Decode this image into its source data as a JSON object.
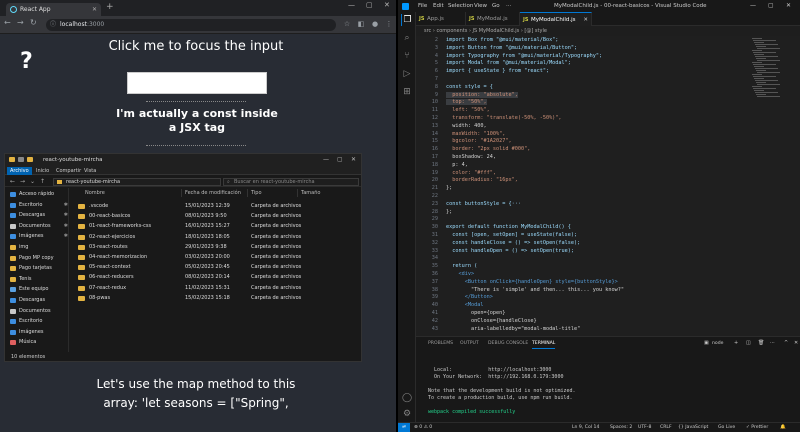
{
  "browser": {
    "tab_title": "React App",
    "url_host": "localhost",
    "url_port": ":3000",
    "content": {
      "focus_text": "Click me to focus the input",
      "question_mark": "?",
      "jsx_text": "I'm actually a const inside a JSX tag",
      "map_text": "Let's use the map method to this array: 'let seasons = [\"Spring\","
    }
  },
  "explorer": {
    "title": "react-youtube-mircha",
    "ribbon_tabs": [
      "Archivo",
      "Inicio",
      "Compartir",
      "Vista"
    ],
    "path": "react-youtube-mircha",
    "search_placeholder": "Buscar en react-youtube-mircha",
    "nav_items": [
      {
        "label": "Acceso rápido",
        "color": "#3d8ee0",
        "active": false
      },
      {
        "label": "Escritorio",
        "color": "#3d8ee0",
        "active": false
      },
      {
        "label": "Descargas",
        "color": "#3d8ee0",
        "active": false
      },
      {
        "label": "Documentos",
        "color": "#c8c8c8",
        "active": false
      },
      {
        "label": "Imágenes",
        "color": "#3d8ee0",
        "active": false
      },
      {
        "label": "img",
        "color": "#e3b341",
        "active": false
      },
      {
        "label": "Pago MP copy",
        "color": "#e3b341",
        "active": false
      },
      {
        "label": "Pago tarjetas",
        "color": "#e3b341",
        "active": false
      },
      {
        "label": "Tenis",
        "color": "#e3b341",
        "active": false
      },
      {
        "label": "Este equipo",
        "color": "#5aa0e0",
        "active": false
      },
      {
        "label": "Descargas",
        "color": "#3d8ee0",
        "active": false
      },
      {
        "label": "Documentos",
        "color": "#c8c8c8",
        "active": false
      },
      {
        "label": "Escritorio",
        "color": "#3d8ee0",
        "active": false
      },
      {
        "label": "Imágenes",
        "color": "#3d8ee0",
        "active": false
      },
      {
        "label": "Música",
        "color": "#e06060",
        "active": false
      }
    ],
    "columns": [
      "Nombre",
      "Fecha de modificación",
      "Tipo",
      "Tamaño"
    ],
    "rows": [
      {
        "name": ".vscode",
        "date": "15/01/2023 12:39",
        "type": "Carpeta de archivos"
      },
      {
        "name": "00-react-basicos",
        "date": "08/01/2023 9:50",
        "type": "Carpeta de archivos"
      },
      {
        "name": "01-react-frameworks-css",
        "date": "16/01/2023 15:27",
        "type": "Carpeta de archivos"
      },
      {
        "name": "02-react-ejercicios",
        "date": "18/01/2023 18:05",
        "type": "Carpeta de archivos"
      },
      {
        "name": "03-react-routes",
        "date": "29/01/2023 9:38",
        "type": "Carpeta de archivos"
      },
      {
        "name": "04-react-memorizacion",
        "date": "03/02/2023 20:00",
        "type": "Carpeta de archivos"
      },
      {
        "name": "05-react-context",
        "date": "05/02/2023 20:45",
        "type": "Carpeta de archivos"
      },
      {
        "name": "06-react-reducers",
        "date": "08/02/2023 20:14",
        "type": "Carpeta de archivos"
      },
      {
        "name": "07-react-redux",
        "date": "11/02/2023 15:31",
        "type": "Carpeta de archivos"
      },
      {
        "name": "08-pwas",
        "date": "15/02/2023 15:18",
        "type": "Carpeta de archivos"
      }
    ],
    "status": "10 elementos"
  },
  "vscode": {
    "menu": [
      "File",
      "Edit",
      "Selection",
      "View",
      "Go",
      "···"
    ],
    "window_title": "MyModalChild.js - 00-react-basicos - Visual Studio Code",
    "tabs": [
      {
        "label": "App.js",
        "active": false
      },
      {
        "label": "MyModal.js",
        "active": false
      },
      {
        "label": "MyModalChild.js",
        "active": true
      }
    ],
    "breadcrumb": "src  ›  components  ›  JS MyModalChild.js  ›  [@] style",
    "code_lines": [
      {
        "n": "2",
        "text": "import Box from \"@mui/material/Box\";"
      },
      {
        "n": "3",
        "text": "import Button from \"@mui/material/Button\";"
      },
      {
        "n": "4",
        "text": "import Typography from \"@mui/material/Typography\";"
      },
      {
        "n": "5",
        "text": "import Modal from \"@mui/material/Modal\";"
      },
      {
        "n": "6",
        "text": "import { useState } from \"react\";"
      },
      {
        "n": "7",
        "text": ""
      },
      {
        "n": "8",
        "text": "const style = {"
      },
      {
        "n": "9",
        "text": "  position: \"absolute\","
      },
      {
        "n": "10",
        "text": "  top: \"50%\","
      },
      {
        "n": "11",
        "text": "  left: \"50%\","
      },
      {
        "n": "12",
        "text": "  transform: \"translate(-50%, -50%)\","
      },
      {
        "n": "13",
        "text": "  width: 400,"
      },
      {
        "n": "14",
        "text": "  maxWidth: \"100%\","
      },
      {
        "n": "15",
        "text": "  bgcolor: \"#1A2027\","
      },
      {
        "n": "16",
        "text": "  border: \"2px solid #000\","
      },
      {
        "n": "17",
        "text": "  boxShadow: 24,"
      },
      {
        "n": "18",
        "text": "  p: 4,"
      },
      {
        "n": "19",
        "text": "  color: \"#fff\","
      },
      {
        "n": "20",
        "text": "  borderRadius: \"16px\","
      },
      {
        "n": "21",
        "text": "};"
      },
      {
        "n": "22",
        "text": ""
      },
      {
        "n": "23",
        "text": "const buttonStyle = {···"
      },
      {
        "n": "28",
        "text": "};"
      },
      {
        "n": "29",
        "text": ""
      },
      {
        "n": "30",
        "text": "export default function MyModalChild() {"
      },
      {
        "n": "31",
        "text": "  const [open, setOpen] = useState(false);"
      },
      {
        "n": "32",
        "text": "  const handleClose = () => setOpen(false);"
      },
      {
        "n": "33",
        "text": "  const handleOpen = () => setOpen(true);"
      },
      {
        "n": "34",
        "text": ""
      },
      {
        "n": "35",
        "text": "  return ("
      },
      {
        "n": "36",
        "text": "    <div>"
      },
      {
        "n": "37",
        "text": "      <Button onClick={handleOpen} style={buttonStyle}>"
      },
      {
        "n": "38",
        "text": "        \"There is 'simple' and then... this... you know?\""
      },
      {
        "n": "39",
        "text": "      </Button>"
      },
      {
        "n": "40",
        "text": "      <Modal"
      },
      {
        "n": "41",
        "text": "        open={open}"
      },
      {
        "n": "42",
        "text": "        onClose={handleClose}"
      },
      {
        "n": "43",
        "text": "        aria-labelledby=\"modal-modal-title\""
      }
    ],
    "panel_tabs": [
      "PROBLEMS",
      "OUTPUT",
      "DEBUG CONSOLE",
      "TERMINAL"
    ],
    "panel_active": "TERMINAL",
    "terminal_label": "node",
    "terminal_lines": [
      "  Local:            http://localhost:3000",
      "  On Your Network:  http://192.168.0.179:3000",
      "",
      "Note that the development build is not optimized.",
      "To create a production build, use npm run build.",
      "",
      "webpack compiled successfully"
    ],
    "status": {
      "errors": "⊗ 0 ⚠ 0",
      "position": "Ln 9, Col 14",
      "spaces": "Spaces: 2",
      "encoding": "UTF-8",
      "eol": "CRLF",
      "language": "{} JavaScript",
      "golive": "Go Live",
      "prettier": "✓ Prettier"
    }
  }
}
